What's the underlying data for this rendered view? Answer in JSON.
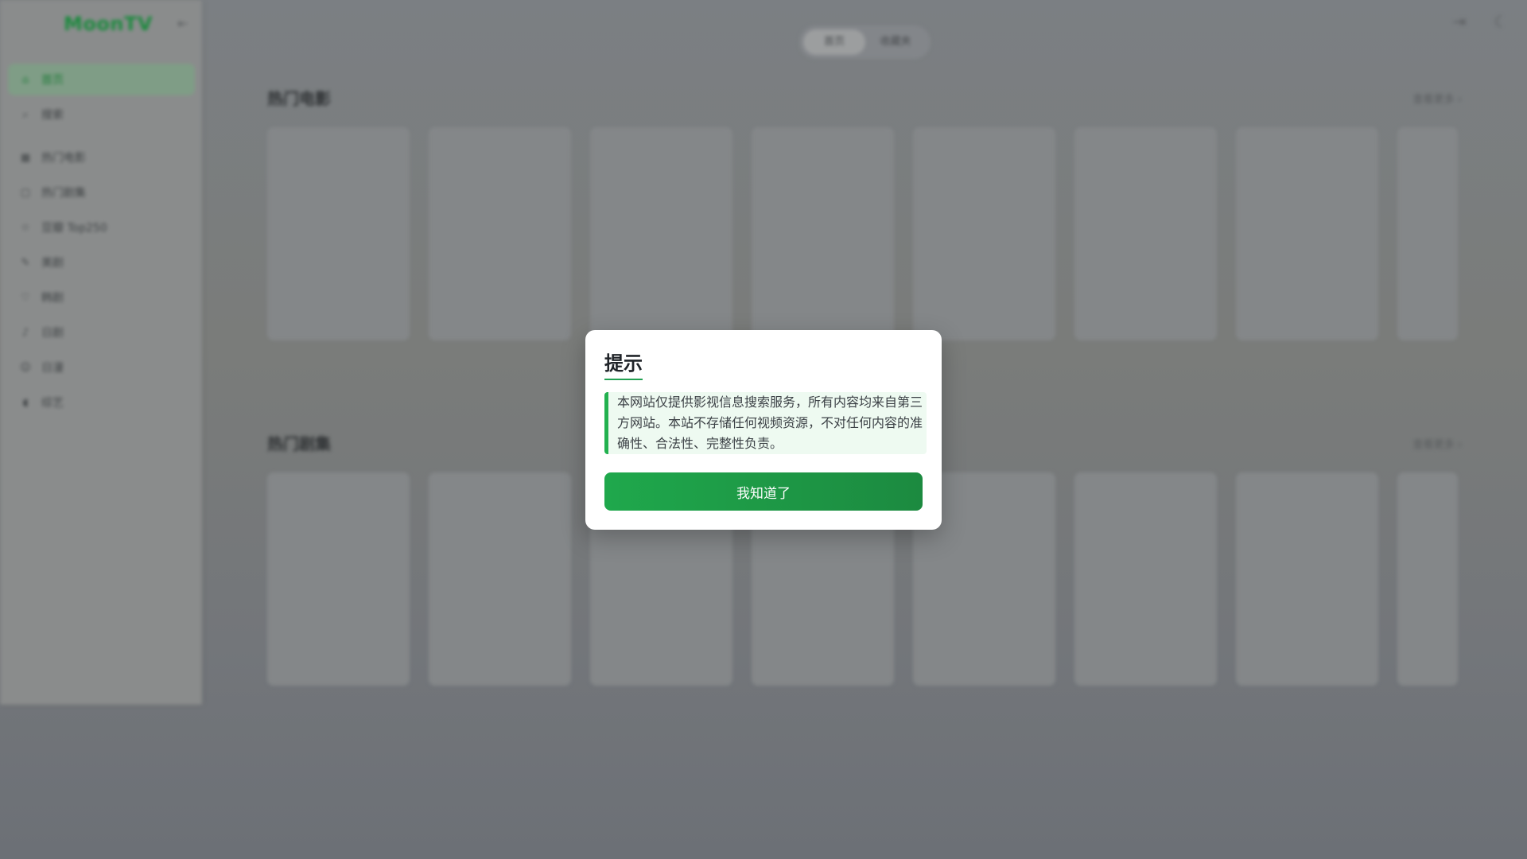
{
  "app": {
    "logo": "MoonTV",
    "collapse_icon": "sidebar-collapse-icon",
    "nav_items": [
      {
        "label": "首页",
        "icon": "home-icon",
        "active": true
      },
      {
        "label": "搜索",
        "icon": "search-icon"
      },
      {
        "label": "热门电影",
        "icon": "film-icon"
      },
      {
        "label": "热门剧集",
        "icon": "tv-icon"
      },
      {
        "label": "豆瓣 Top250",
        "icon": "star-icon"
      },
      {
        "label": "美剧",
        "icon": "clapper-icon"
      },
      {
        "label": "韩剧",
        "icon": "heart-icon"
      },
      {
        "label": "日剧",
        "icon": "music-icon"
      },
      {
        "label": "日漫",
        "icon": "smile-icon"
      },
      {
        "label": "综艺",
        "icon": "mic-icon"
      }
    ],
    "tabs": {
      "home": "首页",
      "favorites": "收藏夹"
    },
    "sections": [
      {
        "title": "热门电影",
        "more": "查看更多 ›"
      },
      {
        "title": "热门剧集",
        "more": "查看更多 ›"
      }
    ],
    "top_icons": [
      "logout-icon",
      "moon-icon"
    ]
  },
  "modal": {
    "title": "提示",
    "notice": "本网站仅提供影视信息搜索服务，所有内容均来自第三方网站。本站不存储任何视频资源，不对任何内容的准确性、合法性、完整性负责。",
    "button_label": "我知道了",
    "accent_color": "#22a152"
  }
}
